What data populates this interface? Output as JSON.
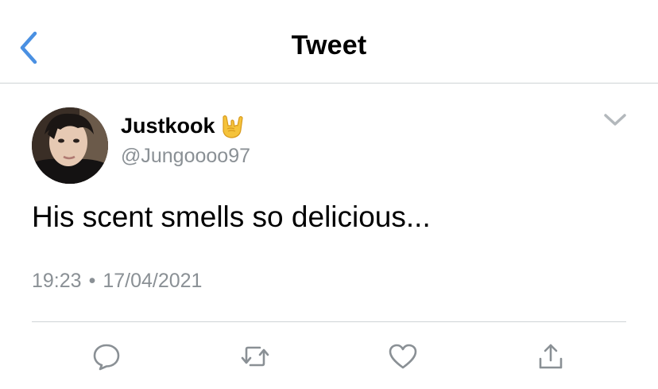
{
  "header": {
    "title": "Tweet",
    "back_icon": "chevron-left-icon",
    "accent_color": "#4a90e2"
  },
  "tweet": {
    "author": {
      "display_name": "Justkook",
      "emoji": "sign-of-the-horns-emoji",
      "handle": "@Jungoooo97"
    },
    "text": "His scent smells so delicious...",
    "time": "19:23",
    "separator": "•",
    "date": "17/04/2021"
  },
  "actions": [
    {
      "name": "reply",
      "icon": "comment-icon"
    },
    {
      "name": "retweet",
      "icon": "retweet-icon"
    },
    {
      "name": "like",
      "icon": "heart-icon"
    },
    {
      "name": "share",
      "icon": "share-icon"
    }
  ],
  "colors": {
    "secondary_text": "#8a9095",
    "icon_gray": "#8a9095",
    "divider": "#cfd3d6"
  }
}
